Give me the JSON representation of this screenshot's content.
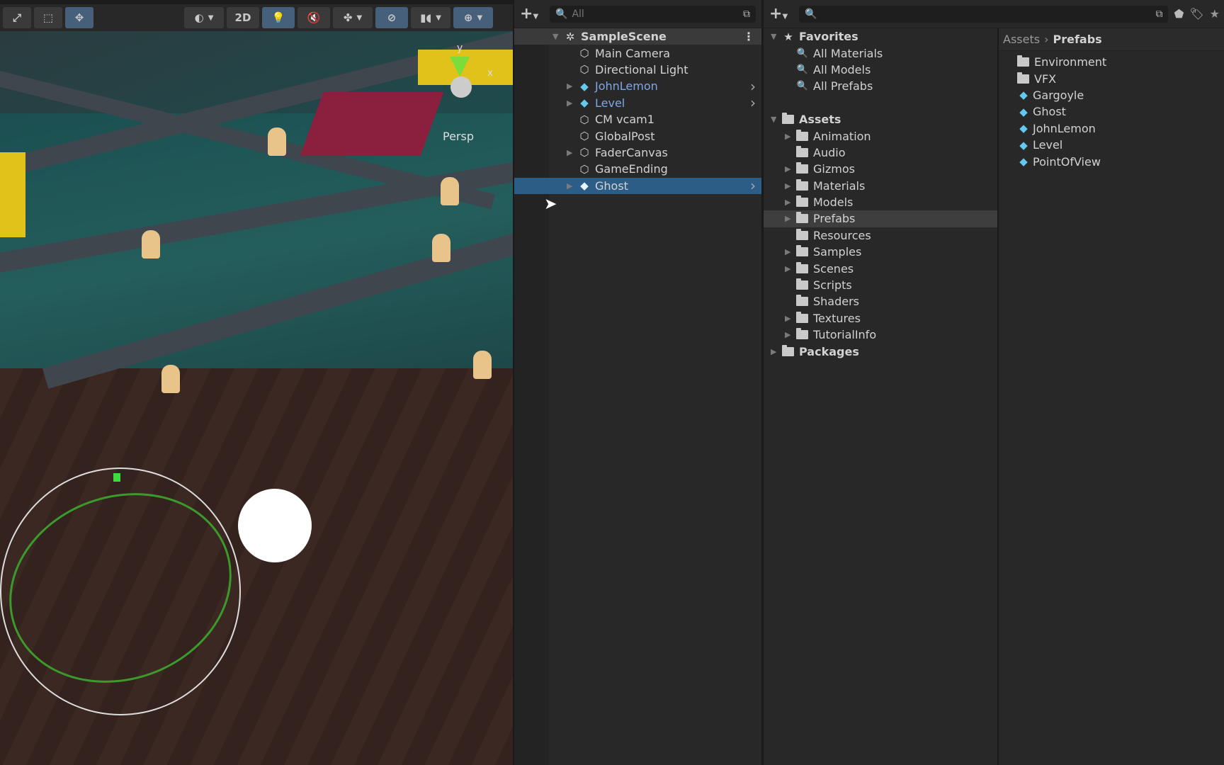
{
  "scene": {
    "toolbar": [
      {
        "icon": "move-tool-icon",
        "active": false
      },
      {
        "icon": "rect-tool-icon",
        "active": false
      },
      {
        "icon": "transform-tool-icon",
        "active": true
      },
      {
        "icon": "shading-mode-icon",
        "active": false,
        "dropdown": true
      },
      {
        "label": "2D",
        "active": false
      },
      {
        "icon": "lighting-icon",
        "active": true
      },
      {
        "icon": "audio-fx-icon",
        "active": false
      },
      {
        "icon": "effects-icon",
        "active": false,
        "dropdown": true
      },
      {
        "icon": "scene-visibility-icon",
        "active": true
      },
      {
        "icon": "camera-icon",
        "active": false,
        "dropdown": true
      },
      {
        "icon": "gizmos-icon",
        "active": true,
        "dropdown": true
      }
    ],
    "orientation_gizmo": {
      "y_label": "y",
      "x_label": "x",
      "projection": "Persp"
    }
  },
  "hierarchy": {
    "search_placeholder": "All",
    "scene_name": "SampleScene",
    "items": [
      {
        "label": "Main Camera",
        "icon": "gameobject",
        "expandable": false
      },
      {
        "label": "Directional Light",
        "icon": "gameobject",
        "expandable": false
      },
      {
        "label": "JohnLemon",
        "icon": "prefab",
        "expandable": true,
        "prefab": true
      },
      {
        "label": "Level",
        "icon": "prefab",
        "expandable": true,
        "prefab": true
      },
      {
        "label": "CM vcam1",
        "icon": "gameobject",
        "expandable": false
      },
      {
        "label": "GlobalPost",
        "icon": "gameobject",
        "expandable": false
      },
      {
        "label": "FaderCanvas",
        "icon": "gameobject",
        "expandable": true
      },
      {
        "label": "GameEnding",
        "icon": "gameobject",
        "expandable": false
      },
      {
        "label": "Ghost",
        "icon": "prefab",
        "expandable": true,
        "prefab": true,
        "selected": true
      }
    ]
  },
  "project": {
    "search_placeholder": "",
    "favorites": {
      "label": "Favorites",
      "items": [
        "All Materials",
        "All Models",
        "All Prefabs"
      ]
    },
    "assets": {
      "label": "Assets",
      "items": [
        {
          "label": "Animation",
          "expandable": true
        },
        {
          "label": "Audio",
          "expandable": false
        },
        {
          "label": "Gizmos",
          "expandable": true
        },
        {
          "label": "Materials",
          "expandable": true
        },
        {
          "label": "Models",
          "expandable": true
        },
        {
          "label": "Prefabs",
          "expandable": true,
          "selected": true
        },
        {
          "label": "Resources",
          "expandable": false
        },
        {
          "label": "Samples",
          "expandable": true
        },
        {
          "label": "Scenes",
          "expandable": true
        },
        {
          "label": "Scripts",
          "expandable": false
        },
        {
          "label": "Shaders",
          "expandable": false
        },
        {
          "label": "Textures",
          "expandable": true
        },
        {
          "label": "TutorialInfo",
          "expandable": true
        }
      ]
    },
    "packages": {
      "label": "Packages"
    },
    "breadcrumb": [
      "Assets",
      "Prefabs"
    ],
    "contents": [
      {
        "label": "Environment",
        "type": "folder"
      },
      {
        "label": "VFX",
        "type": "folder"
      },
      {
        "label": "Gargoyle",
        "type": "prefab"
      },
      {
        "label": "Ghost",
        "type": "prefab"
      },
      {
        "label": "JohnLemon",
        "type": "prefab"
      },
      {
        "label": "Level",
        "type": "prefab"
      },
      {
        "label": "PointOfView",
        "type": "prefab"
      }
    ]
  },
  "colors": {
    "selection": "#2c5d87",
    "prefab": "#63c9ef",
    "prefab_text": "#7fa7e6",
    "active_button": "#46607c"
  }
}
